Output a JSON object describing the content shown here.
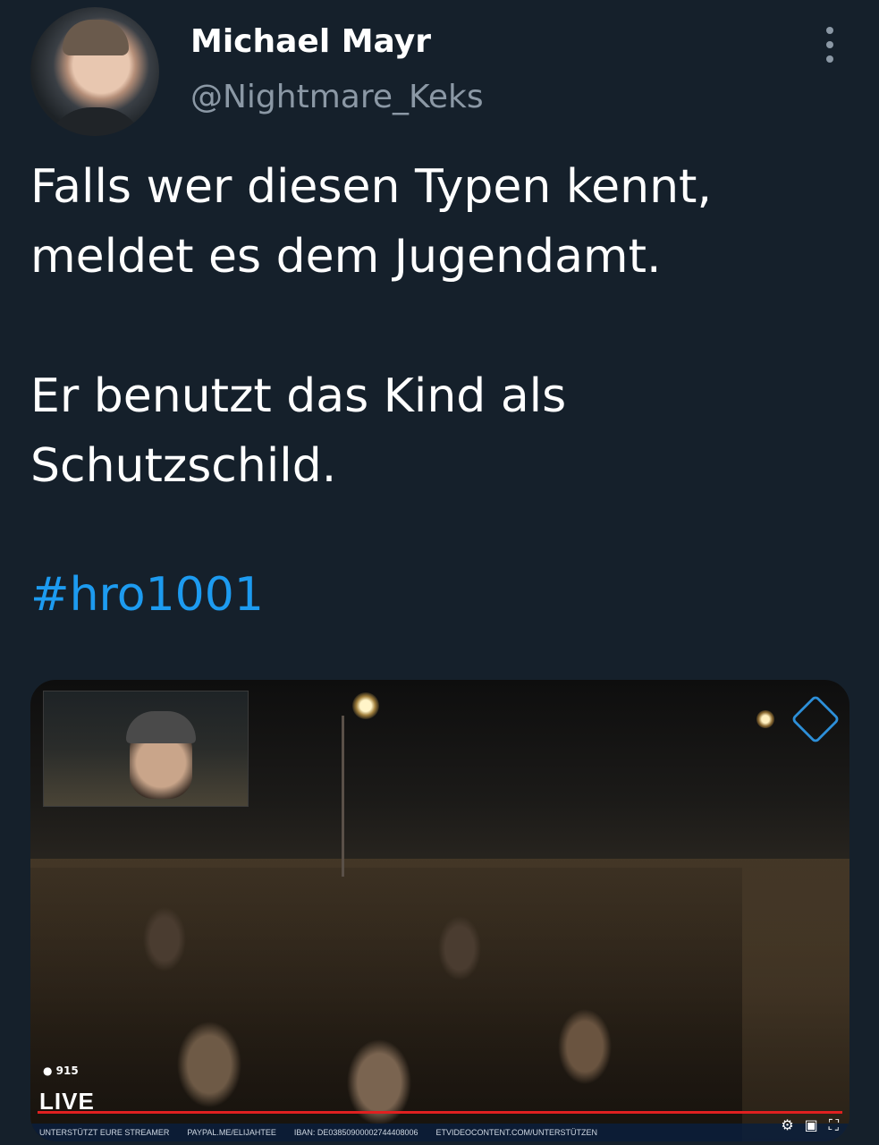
{
  "tweet": {
    "author_name": "Michael Mayr",
    "author_handle": "@Nightmare_Keks",
    "text_lines": [
      "Falls wer diesen Typen kennt,",
      "meldet es dem Jugendamt.",
      "",
      "Er benutzt das Kind als",
      "Schutzschild."
    ],
    "hashtag": "#hro1001"
  },
  "media": {
    "viewer_count": "915",
    "live_badge": "LIVE",
    "ticker": [
      "UNTERSTÜTZT EURE STREAMER",
      "PAYPAL.ME/ELIJAHTEE",
      "IBAN: DE03850900002744408006",
      "ETVIDEOCONTENT.COM/UNTERSTÜTZEN"
    ]
  },
  "icons": {
    "more": "more-vertical-icon"
  },
  "colors": {
    "background": "#15202b",
    "handle": "#8b98a5",
    "hashtag": "#1d9bf0"
  }
}
